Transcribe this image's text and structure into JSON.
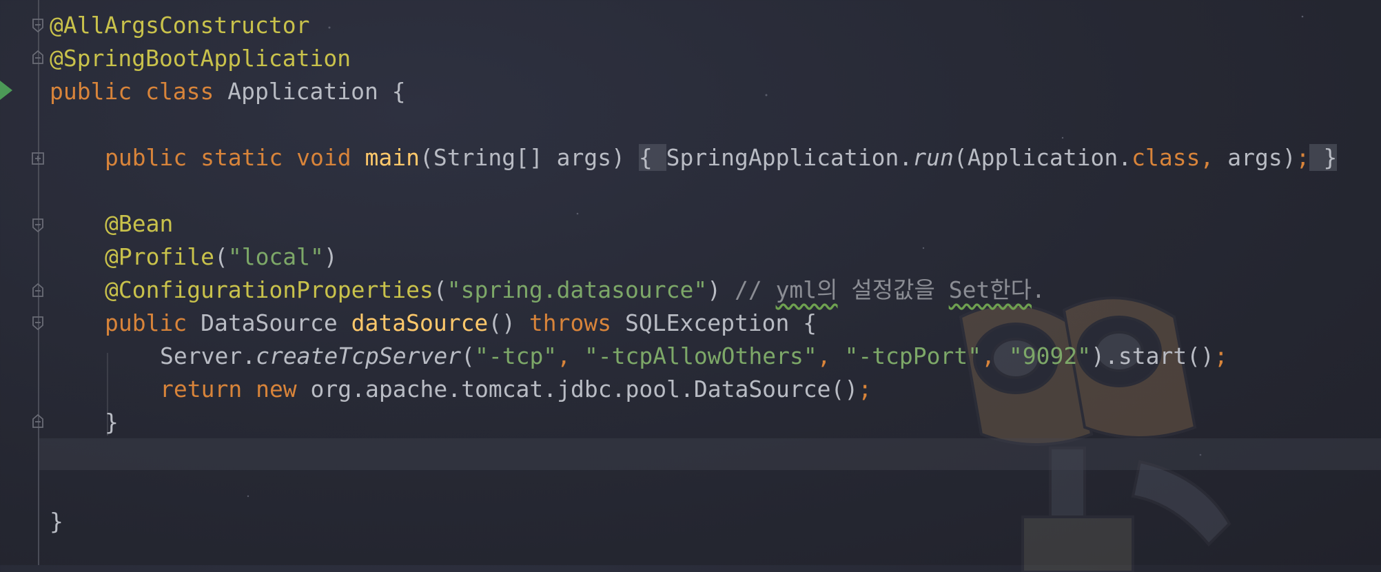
{
  "editor": {
    "lines": [
      {
        "id": "l1",
        "tokens": [
          {
            "t": "@AllArgsConstructor",
            "c": "ann"
          }
        ]
      },
      {
        "id": "l2",
        "tokens": [
          {
            "t": "@SpringBootApplication",
            "c": "ann"
          }
        ]
      },
      {
        "id": "l3",
        "tokens": [
          {
            "t": "public class ",
            "c": "kw"
          },
          {
            "t": "Application {",
            "c": "plain"
          }
        ]
      },
      {
        "id": "l4",
        "tokens": [
          {
            "t": "public static void ",
            "c": "kw"
          },
          {
            "t": "main",
            "c": "fn"
          },
          {
            "t": "(String[] args) ",
            "c": "plain"
          },
          {
            "t": "{ ",
            "c": "plain fold-bg"
          },
          {
            "t": "SpringApplication.",
            "c": "plain"
          },
          {
            "t": "run",
            "c": "plain it"
          },
          {
            "t": "(Application.",
            "c": "plain"
          },
          {
            "t": "class",
            "c": "kw"
          },
          {
            "t": ", ",
            "c": "kw"
          },
          {
            "t": "args)",
            "c": "plain"
          },
          {
            "t": ";",
            "c": "kw"
          },
          {
            "t": " }",
            "c": "plain fold-bg"
          }
        ]
      },
      {
        "id": "l5",
        "tokens": [
          {
            "t": "@Bean",
            "c": "ann"
          }
        ]
      },
      {
        "id": "l6",
        "tokens": [
          {
            "t": "@Profile",
            "c": "ann"
          },
          {
            "t": "(",
            "c": "plain"
          },
          {
            "t": "\"local\"",
            "c": "str"
          },
          {
            "t": ")",
            "c": "plain"
          }
        ]
      },
      {
        "id": "l7",
        "tokens": [
          {
            "t": "@ConfigurationProperties",
            "c": "ann"
          },
          {
            "t": "(",
            "c": "plain"
          },
          {
            "t": "\"spring.datasource\"",
            "c": "str"
          },
          {
            "t": ") ",
            "c": "plain"
          },
          {
            "t": "// ",
            "c": "cm"
          },
          {
            "t": "yml의",
            "c": "cm squiggle"
          },
          {
            "t": " 설정값을 ",
            "c": "cm"
          },
          {
            "t": "Set한다",
            "c": "cm squiggle"
          },
          {
            "t": ".",
            "c": "cm"
          }
        ]
      },
      {
        "id": "l8",
        "tokens": [
          {
            "t": "public ",
            "c": "kw"
          },
          {
            "t": "DataSource ",
            "c": "plain"
          },
          {
            "t": "dataSource",
            "c": "fn"
          },
          {
            "t": "() ",
            "c": "plain"
          },
          {
            "t": "throws ",
            "c": "kw"
          },
          {
            "t": "SQLException {",
            "c": "plain"
          }
        ]
      },
      {
        "id": "l9",
        "tokens": [
          {
            "t": "Server.",
            "c": "plain"
          },
          {
            "t": "createTcpServer",
            "c": "plain it"
          },
          {
            "t": "(",
            "c": "plain"
          },
          {
            "t": "\"-tcp\"",
            "c": "str"
          },
          {
            "t": ", ",
            "c": "kw"
          },
          {
            "t": "\"-tcpAllowOthers\"",
            "c": "str"
          },
          {
            "t": ", ",
            "c": "kw"
          },
          {
            "t": "\"-tcpPort\"",
            "c": "str"
          },
          {
            "t": ", ",
            "c": "kw"
          },
          {
            "t": "\"9092\"",
            "c": "str"
          },
          {
            "t": ").start()",
            "c": "plain"
          },
          {
            "t": ";",
            "c": "kw"
          }
        ]
      },
      {
        "id": "l10",
        "tokens": [
          {
            "t": "return new ",
            "c": "kw"
          },
          {
            "t": "org.apache.tomcat.jdbc.pool.DataSource()",
            "c": "plain"
          },
          {
            "t": ";",
            "c": "kw"
          }
        ]
      },
      {
        "id": "l11",
        "tokens": [
          {
            "t": "}",
            "c": "plain"
          }
        ]
      },
      {
        "id": "l12",
        "tokens": [
          {
            "t": "}",
            "c": "plain"
          }
        ]
      }
    ]
  },
  "colors": {
    "keyword": "#d8843a",
    "annotation": "#c9c24b",
    "method": "#ffc96b",
    "string": "#7da868",
    "comment": "#8b8d94",
    "text": "#b9bcc4",
    "run_icon": "#4c9a57"
  },
  "icons": {
    "run": "run-gutter-icon",
    "fold": "fold-marker-icon",
    "expand": "expand-fold-icon"
  }
}
